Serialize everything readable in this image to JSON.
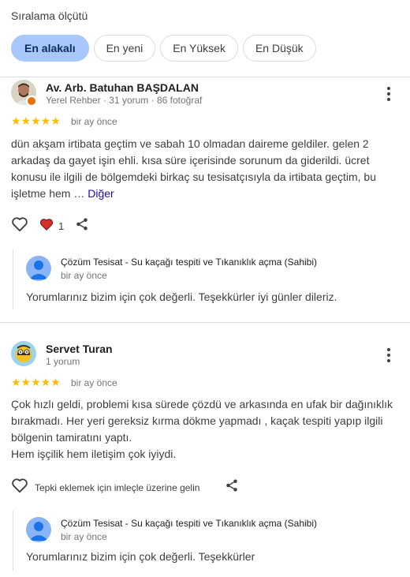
{
  "sort": {
    "label": "Sıralama ölçütü",
    "options": [
      "En alakalı",
      "En yeni",
      "En Yüksek",
      "En Düşük"
    ]
  },
  "reviews": [
    {
      "name": "Av. Arb. Batuhan BAŞDALAN",
      "meta": "Yerel Rehber · 31 yorum · 86 fotoğraf",
      "stars": "★★★★★",
      "when": "bir ay önce",
      "text": "dün akşam irtibata geçtim ve sabah 10 olmadan daireme geldiler. gelen 2 arkadaş da gayet işin ehli. kısa süre içerisinde sorunum da giderildi. ücret konusu ile ilgili de bölgemdeki birkaç su tesisatçısıyla da irtibata geçtim, bu işletme hem …",
      "more_link": "Diğer",
      "like_count": "1",
      "reply": {
        "name": "Çözüm Tesisat - Su kaçağı tespiti ve Tıkanıklık açma (Sahibi)",
        "when": "bir ay önce",
        "text": "Yorumlarınız bizim için çok değerli. Teşekkürler iyi günler dileriz."
      }
    },
    {
      "name": "Servet Turan",
      "meta": "1 yorum",
      "stars": "★★★★★",
      "when": "bir ay önce",
      "text_lines": [
        "Çok hızlı geldi, problemi kısa sürede çözdü ve arkasında en ufak bir dağınıklık",
        "bırakmadı. Her yeri gereksiz kırma dökme yapmadı , kaçak tespiti yapıp ilgili",
        "bölgenin tamiratını yaptı.",
        "Hem işçilik hem iletişim çok iyiydi."
      ],
      "reaction_hint": "Tepki eklemek için imleçle üzerine gelin",
      "reply": {
        "name": "Çözüm Tesisat - Su kaçağı tespiti ve Tıkanıklık açma (Sahibi)",
        "when": "bir ay önce",
        "text": "Yorumlarınız bizim için çok değerli. Teşekkürler"
      }
    }
  ],
  "colors": {
    "accent_chip": "#a8c7fa",
    "star": "#fbbc04",
    "heart": "#d93025",
    "link": "#1a0dab"
  }
}
